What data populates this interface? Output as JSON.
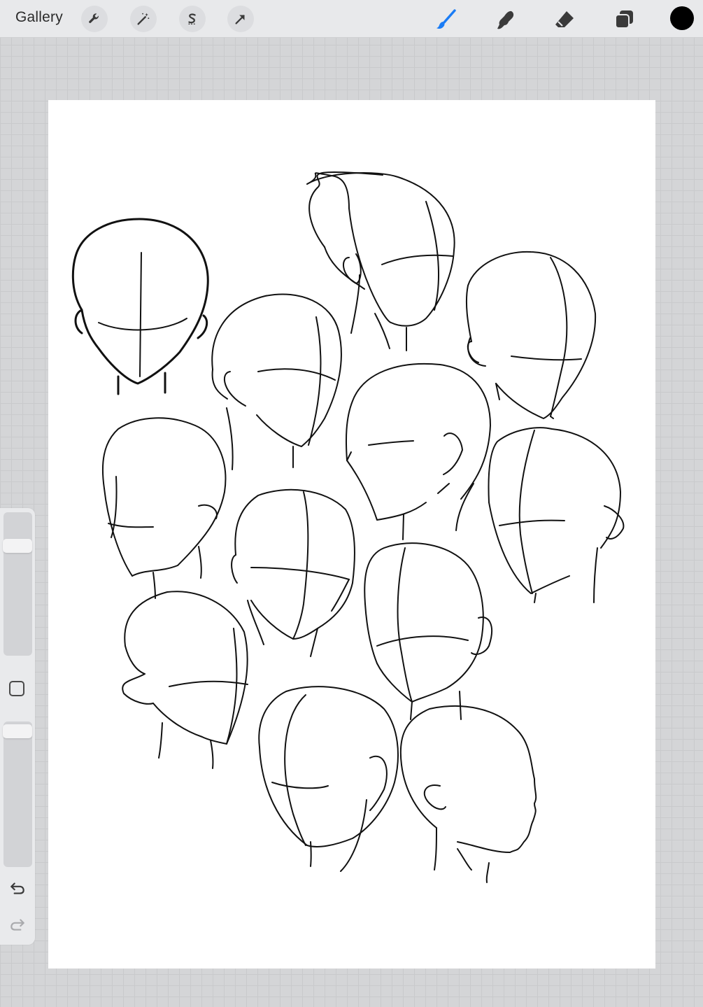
{
  "app": {
    "gallery_label": "Gallery"
  },
  "toolbar": {
    "left_tools": [
      "wrench-icon",
      "magic-wand-icon",
      "selection-s-icon",
      "transform-arrow-icon"
    ],
    "right_tools": [
      "brush-icon",
      "smudge-icon",
      "eraser-icon",
      "layers-icon"
    ],
    "active_tool": "brush-icon",
    "active_color": "#000000",
    "accent_color": "#1a7cf5"
  },
  "sidebar": {
    "brush_size_level": 0.1,
    "opacity_level": 0.0,
    "modify_icon": "square-modify-icon",
    "undo_icon": "undo-icon",
    "redo_icon": "redo-icon",
    "redo_enabled": false
  },
  "canvas": {
    "background": "#ffffff",
    "content": "line-drawing-of-head-studies"
  }
}
